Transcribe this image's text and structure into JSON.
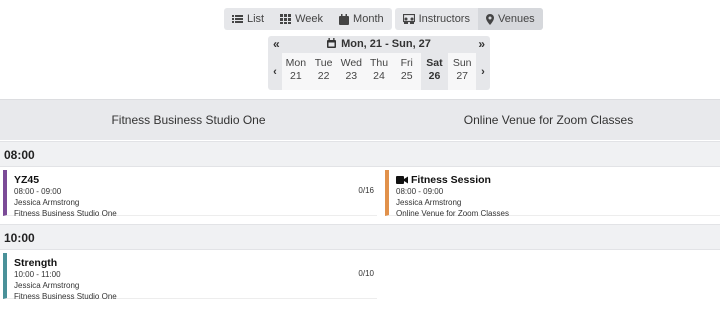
{
  "toolbar": {
    "views": [
      {
        "label": "List",
        "icon": "list-icon"
      },
      {
        "label": "Week",
        "icon": "grid-icon"
      },
      {
        "label": "Month",
        "icon": "calendar-icon"
      }
    ],
    "groupings": [
      {
        "label": "Instructors",
        "icon": "instructors-icon"
      },
      {
        "label": "Venues",
        "icon": "map-marker-icon",
        "active": true
      }
    ]
  },
  "date_nav": {
    "range": "Mon, 21 - Sun, 27",
    "prev_week": "«",
    "next_week": "»",
    "prev_day": "‹",
    "next_day": "›",
    "days": [
      {
        "name": "Mon",
        "num": "21"
      },
      {
        "name": "Tue",
        "num": "22"
      },
      {
        "name": "Wed",
        "num": "23"
      },
      {
        "name": "Thu",
        "num": "24"
      },
      {
        "name": "Fri",
        "num": "25"
      },
      {
        "name": "Sat",
        "num": "26",
        "active": true
      },
      {
        "name": "Sun",
        "num": "27"
      }
    ]
  },
  "venues": [
    "Fitness Business Studio One",
    "Online Venue for Zoom Classes"
  ],
  "time_slots": [
    "08:00",
    "10:00"
  ],
  "sessions": [
    {
      "title": "YZ45",
      "time": "08:00 - 09:00",
      "instructor": "Jessica Armstrong",
      "venue": "Fitness Business Studio One",
      "count": "0/16",
      "color": "#7b4b97",
      "icon": ""
    },
    {
      "title": "Fitness Session",
      "time": "08:00 - 09:00",
      "instructor": "Jessica Armstrong",
      "venue": "Online Venue for Zoom Classes",
      "count": "",
      "color": "#e1914b",
      "icon": "video-icon"
    },
    {
      "title": "Strength",
      "time": "10:00 - 11:00",
      "instructor": "Jessica Armstrong",
      "venue": "Fitness Business Studio One",
      "count": "0/10",
      "color": "#4a9199",
      "icon": ""
    }
  ]
}
